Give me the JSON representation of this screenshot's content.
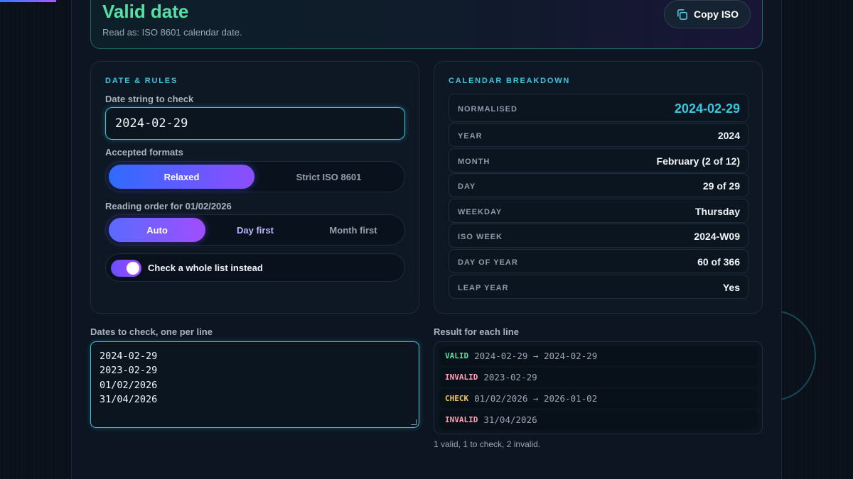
{
  "hero": {
    "title": "Valid date",
    "subtitle": "Read as: ISO 8601 calendar date.",
    "copy_label": "Copy ISO"
  },
  "rules": {
    "section_title": "DATE & RULES",
    "input_label": "Date string to check",
    "input_value": "2024-02-29",
    "formats_label": "Accepted formats",
    "formats": [
      "Relaxed",
      "Strict ISO 8601"
    ],
    "formats_selected": "Relaxed",
    "order_label": "Reading order for 01/02/2026",
    "orders": [
      "Auto",
      "Day first",
      "Month first"
    ],
    "order_selected": "Auto",
    "toggle_label": "Check a whole list instead",
    "toggle_on": true
  },
  "breakdown": {
    "section_title": "CALENDAR BREAKDOWN",
    "rows": [
      {
        "key": "NORMALISED",
        "value": "2024-02-29"
      },
      {
        "key": "YEAR",
        "value": "2024"
      },
      {
        "key": "MONTH",
        "value": "February (2 of 12)"
      },
      {
        "key": "DAY",
        "value": "29 of 29"
      },
      {
        "key": "WEEKDAY",
        "value": "Thursday"
      },
      {
        "key": "ISO WEEK",
        "value": "2024-W09"
      },
      {
        "key": "DAY OF YEAR",
        "value": "60 of 366"
      },
      {
        "key": "LEAP YEAR",
        "value": "Yes"
      }
    ]
  },
  "list": {
    "input_label": "Dates to check, one per line",
    "lines": [
      "2024-02-29",
      "2023-02-29",
      "01/02/2026",
      "31/04/2026"
    ],
    "results_label": "Result for each line",
    "results": [
      {
        "status": "VALID",
        "text": "2024-02-29 → 2024-02-29"
      },
      {
        "status": "INVALID",
        "text": "2023-02-29"
      },
      {
        "status": "CHECK",
        "text": "01/02/2026 → 2026-01-02"
      },
      {
        "status": "INVALID",
        "text": "31/04/2026"
      }
    ],
    "summary": "1 valid, 1 to check, 2 invalid."
  },
  "colors": {
    "valid": "#55e0a4",
    "invalid": "#ff9fb3",
    "check": "#f2c94c",
    "accent": "#38c6e0"
  }
}
